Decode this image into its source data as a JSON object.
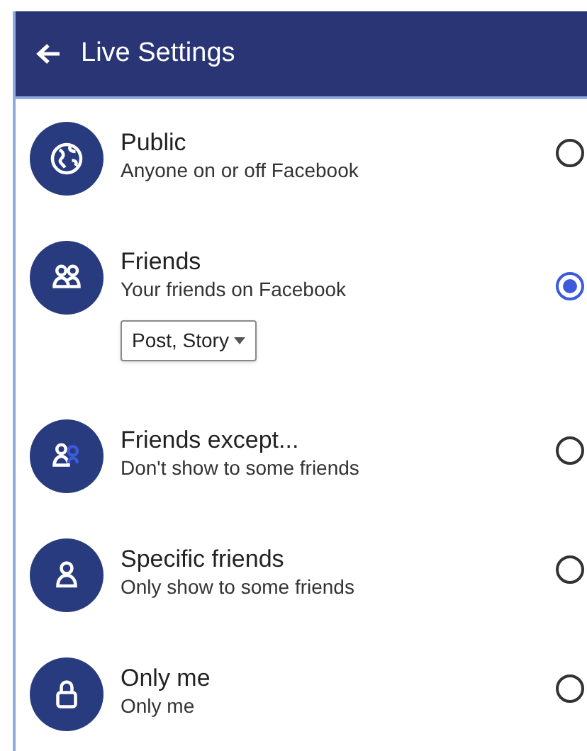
{
  "header": {
    "title": "Live Settings"
  },
  "options": [
    {
      "kind": "globe",
      "title": "Public",
      "subtitle": "Anyone on or off Facebook",
      "selected": false
    },
    {
      "kind": "friends",
      "title": "Friends",
      "subtitle": "Your friends on Facebook",
      "selected": true,
      "dropdown": "Post, Story"
    },
    {
      "kind": "friends-except",
      "title": "Friends except...",
      "subtitle": "Don't show to some friends",
      "selected": false
    },
    {
      "kind": "person",
      "title": "Specific friends",
      "subtitle": "Only show to some friends",
      "selected": false
    },
    {
      "kind": "lock",
      "title": "Only me",
      "subtitle": "Only me",
      "selected": false
    }
  ]
}
